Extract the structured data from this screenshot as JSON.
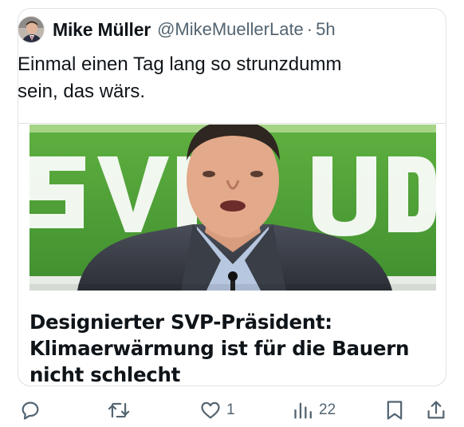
{
  "tweet": {
    "author_name": "Mike Müller",
    "handle": "@MikeMuellerLate",
    "separator": "·",
    "time": "5h",
    "text_line1": "Einmal einen Tag lang so strunzdumm",
    "text_line2": "sein, das wärs."
  },
  "link_card": {
    "image_backdrop_text": "SVP UDC",
    "headline_line1": "Designierter SVP-Präsident:",
    "headline_line2": "Klimaerwärmung ist für die Bauern",
    "headline_line3": "nicht schlecht"
  },
  "actions": {
    "reply_icon": "reply-icon",
    "repost_icon": "repost-icon",
    "like_icon": "heart-icon",
    "like_count": "1",
    "views_icon": "views-icon",
    "views_count": "22",
    "bookmark_icon": "bookmark-icon",
    "share_icon": "share-icon"
  },
  "colors": {
    "text": "#0f1419",
    "secondary": "#536471",
    "border": "#dfe3e7",
    "svp_green": "#4fa23a"
  }
}
